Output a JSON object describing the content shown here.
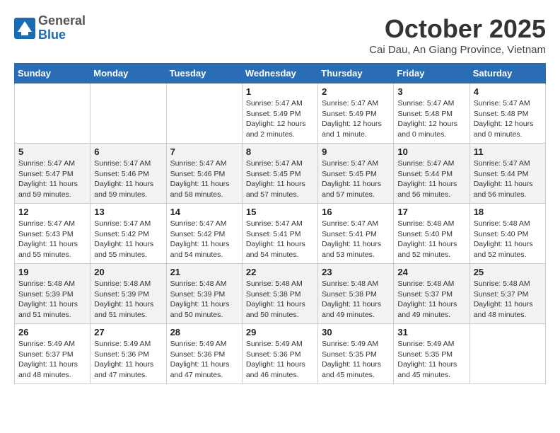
{
  "header": {
    "logo_general": "General",
    "logo_blue": "Blue",
    "month_title": "October 2025",
    "location": "Cai Dau, An Giang Province, Vietnam"
  },
  "weekdays": [
    "Sunday",
    "Monday",
    "Tuesday",
    "Wednesday",
    "Thursday",
    "Friday",
    "Saturday"
  ],
  "weeks": [
    [
      {
        "day": "",
        "sunrise": "",
        "sunset": "",
        "daylight": ""
      },
      {
        "day": "",
        "sunrise": "",
        "sunset": "",
        "daylight": ""
      },
      {
        "day": "",
        "sunrise": "",
        "sunset": "",
        "daylight": ""
      },
      {
        "day": "1",
        "sunrise": "Sunrise: 5:47 AM",
        "sunset": "Sunset: 5:49 PM",
        "daylight": "Daylight: 12 hours and 2 minutes."
      },
      {
        "day": "2",
        "sunrise": "Sunrise: 5:47 AM",
        "sunset": "Sunset: 5:49 PM",
        "daylight": "Daylight: 12 hours and 1 minute."
      },
      {
        "day": "3",
        "sunrise": "Sunrise: 5:47 AM",
        "sunset": "Sunset: 5:48 PM",
        "daylight": "Daylight: 12 hours and 0 minutes."
      },
      {
        "day": "4",
        "sunrise": "Sunrise: 5:47 AM",
        "sunset": "Sunset: 5:48 PM",
        "daylight": "Daylight: 12 hours and 0 minutes."
      }
    ],
    [
      {
        "day": "5",
        "sunrise": "Sunrise: 5:47 AM",
        "sunset": "Sunset: 5:47 PM",
        "daylight": "Daylight: 11 hours and 59 minutes."
      },
      {
        "day": "6",
        "sunrise": "Sunrise: 5:47 AM",
        "sunset": "Sunset: 5:46 PM",
        "daylight": "Daylight: 11 hours and 59 minutes."
      },
      {
        "day": "7",
        "sunrise": "Sunrise: 5:47 AM",
        "sunset": "Sunset: 5:46 PM",
        "daylight": "Daylight: 11 hours and 58 minutes."
      },
      {
        "day": "8",
        "sunrise": "Sunrise: 5:47 AM",
        "sunset": "Sunset: 5:45 PM",
        "daylight": "Daylight: 11 hours and 57 minutes."
      },
      {
        "day": "9",
        "sunrise": "Sunrise: 5:47 AM",
        "sunset": "Sunset: 5:45 PM",
        "daylight": "Daylight: 11 hours and 57 minutes."
      },
      {
        "day": "10",
        "sunrise": "Sunrise: 5:47 AM",
        "sunset": "Sunset: 5:44 PM",
        "daylight": "Daylight: 11 hours and 56 minutes."
      },
      {
        "day": "11",
        "sunrise": "Sunrise: 5:47 AM",
        "sunset": "Sunset: 5:44 PM",
        "daylight": "Daylight: 11 hours and 56 minutes."
      }
    ],
    [
      {
        "day": "12",
        "sunrise": "Sunrise: 5:47 AM",
        "sunset": "Sunset: 5:43 PM",
        "daylight": "Daylight: 11 hours and 55 minutes."
      },
      {
        "day": "13",
        "sunrise": "Sunrise: 5:47 AM",
        "sunset": "Sunset: 5:42 PM",
        "daylight": "Daylight: 11 hours and 55 minutes."
      },
      {
        "day": "14",
        "sunrise": "Sunrise: 5:47 AM",
        "sunset": "Sunset: 5:42 PM",
        "daylight": "Daylight: 11 hours and 54 minutes."
      },
      {
        "day": "15",
        "sunrise": "Sunrise: 5:47 AM",
        "sunset": "Sunset: 5:41 PM",
        "daylight": "Daylight: 11 hours and 54 minutes."
      },
      {
        "day": "16",
        "sunrise": "Sunrise: 5:47 AM",
        "sunset": "Sunset: 5:41 PM",
        "daylight": "Daylight: 11 hours and 53 minutes."
      },
      {
        "day": "17",
        "sunrise": "Sunrise: 5:48 AM",
        "sunset": "Sunset: 5:40 PM",
        "daylight": "Daylight: 11 hours and 52 minutes."
      },
      {
        "day": "18",
        "sunrise": "Sunrise: 5:48 AM",
        "sunset": "Sunset: 5:40 PM",
        "daylight": "Daylight: 11 hours and 52 minutes."
      }
    ],
    [
      {
        "day": "19",
        "sunrise": "Sunrise: 5:48 AM",
        "sunset": "Sunset: 5:39 PM",
        "daylight": "Daylight: 11 hours and 51 minutes."
      },
      {
        "day": "20",
        "sunrise": "Sunrise: 5:48 AM",
        "sunset": "Sunset: 5:39 PM",
        "daylight": "Daylight: 11 hours and 51 minutes."
      },
      {
        "day": "21",
        "sunrise": "Sunrise: 5:48 AM",
        "sunset": "Sunset: 5:39 PM",
        "daylight": "Daylight: 11 hours and 50 minutes."
      },
      {
        "day": "22",
        "sunrise": "Sunrise: 5:48 AM",
        "sunset": "Sunset: 5:38 PM",
        "daylight": "Daylight: 11 hours and 50 minutes."
      },
      {
        "day": "23",
        "sunrise": "Sunrise: 5:48 AM",
        "sunset": "Sunset: 5:38 PM",
        "daylight": "Daylight: 11 hours and 49 minutes."
      },
      {
        "day": "24",
        "sunrise": "Sunrise: 5:48 AM",
        "sunset": "Sunset: 5:37 PM",
        "daylight": "Daylight: 11 hours and 49 minutes."
      },
      {
        "day": "25",
        "sunrise": "Sunrise: 5:48 AM",
        "sunset": "Sunset: 5:37 PM",
        "daylight": "Daylight: 11 hours and 48 minutes."
      }
    ],
    [
      {
        "day": "26",
        "sunrise": "Sunrise: 5:49 AM",
        "sunset": "Sunset: 5:37 PM",
        "daylight": "Daylight: 11 hours and 48 minutes."
      },
      {
        "day": "27",
        "sunrise": "Sunrise: 5:49 AM",
        "sunset": "Sunset: 5:36 PM",
        "daylight": "Daylight: 11 hours and 47 minutes."
      },
      {
        "day": "28",
        "sunrise": "Sunrise: 5:49 AM",
        "sunset": "Sunset: 5:36 PM",
        "daylight": "Daylight: 11 hours and 47 minutes."
      },
      {
        "day": "29",
        "sunrise": "Sunrise: 5:49 AM",
        "sunset": "Sunset: 5:36 PM",
        "daylight": "Daylight: 11 hours and 46 minutes."
      },
      {
        "day": "30",
        "sunrise": "Sunrise: 5:49 AM",
        "sunset": "Sunset: 5:35 PM",
        "daylight": "Daylight: 11 hours and 45 minutes."
      },
      {
        "day": "31",
        "sunrise": "Sunrise: 5:49 AM",
        "sunset": "Sunset: 5:35 PM",
        "daylight": "Daylight: 11 hours and 45 minutes."
      },
      {
        "day": "",
        "sunrise": "",
        "sunset": "",
        "daylight": ""
      }
    ]
  ]
}
